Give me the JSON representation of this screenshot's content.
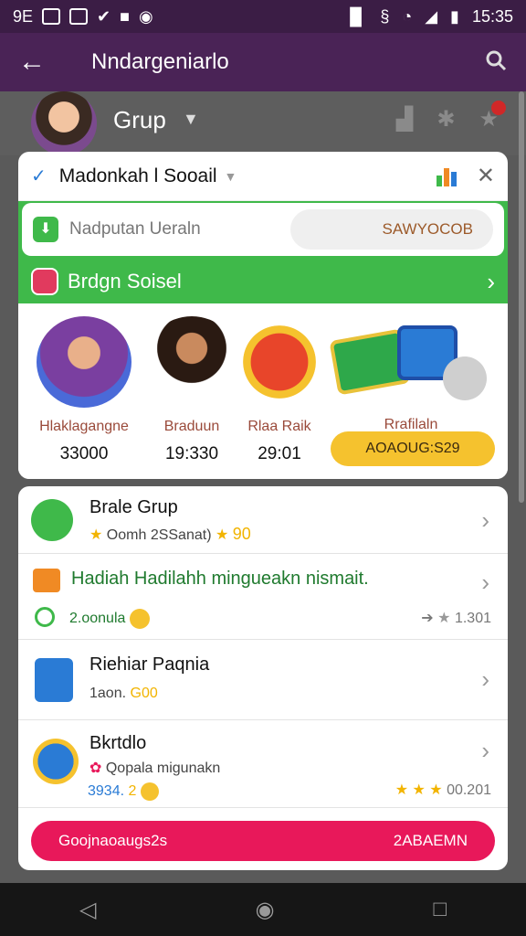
{
  "status_bar": {
    "left_text": "9E",
    "time": "15:35"
  },
  "app_bar": {
    "title": "Nndargeniarlo"
  },
  "header": {
    "group_label": "Grup"
  },
  "card1": {
    "title": "Madonkah l Sooail",
    "input_placeholder": "Nadputan Ueraln",
    "input_pill": "SAWYOCOB",
    "banner_label": "Brdgn Soisel",
    "tiles": [
      {
        "name": "Hlaklagangne",
        "value": "33000"
      },
      {
        "name": "Braduun",
        "value": "19:330"
      },
      {
        "name": "Rlaa Raik",
        "value": "29:01"
      },
      {
        "name": "Rrafilaln",
        "value": ""
      }
    ],
    "gold_pill": "AOAOUG:S29"
  },
  "list": {
    "items": [
      {
        "title": "Brale Grup",
        "sub": "Oomh 2SSanat)",
        "value": "90"
      },
      {
        "title": "Hadiah Hadilahh mingueakn nismait.",
        "sub": "2.oonula",
        "value": "1.301"
      },
      {
        "title": "Riehiar Paqnia",
        "sub": "1aon.",
        "value": "G00"
      },
      {
        "title": "Bkrtdlo",
        "sub": "Qopala migunakn",
        "sub2": "3934.",
        "value": "00.201"
      }
    ]
  },
  "cta": {
    "left": "Goojnaoaugs2s",
    "right": "2ABAEMN"
  },
  "colors": {
    "accent_green": "#3fb94a",
    "primary_purple": "#4a2356",
    "cta_pink": "#e8185a"
  }
}
